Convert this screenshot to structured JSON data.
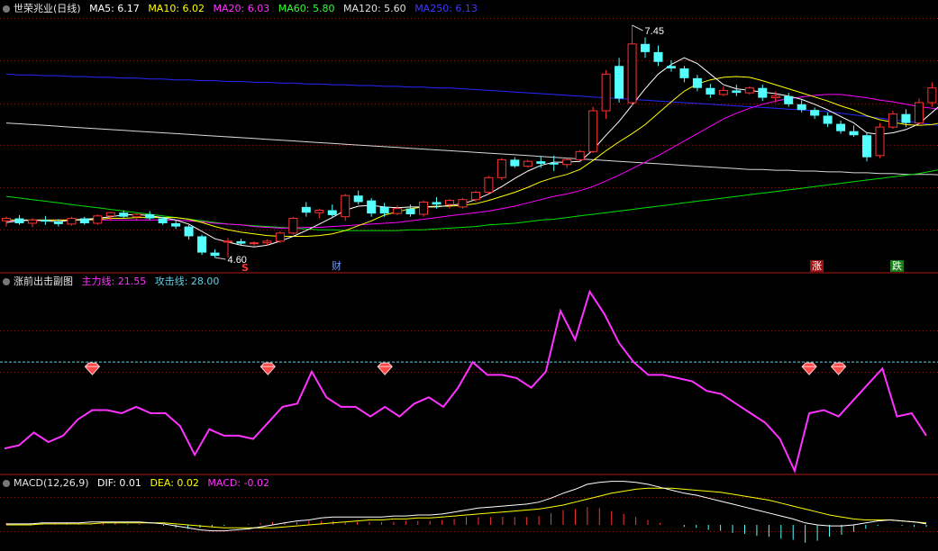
{
  "colors": {
    "bg": "#000000",
    "up": "#ff3232",
    "down": "#54ffff",
    "grid": "#8b1a1a",
    "ma5": "#ffffff",
    "ma10": "#ffff00",
    "ma20": "#ff00ff",
    "ma60": "#00e000",
    "ma120": "#d8d8d8",
    "ma250": "#2828ff",
    "main_line": "#ff33ff",
    "attack_line": "#5fd2e6",
    "dif": "#ffffff",
    "dea": "#ffff00",
    "macd_label": "#ff33ff"
  },
  "main_panel": {
    "stock_name": "世荣兆业",
    "period": "(日线)",
    "ma_labels": [
      {
        "label": "MA5: 6.17",
        "color": "#ffffff"
      },
      {
        "label": "MA10: 6.02",
        "color": "#ffff00"
      },
      {
        "label": "MA20: 6.03",
        "color": "#ff33ff"
      },
      {
        "label": "MA60: 5.80",
        "color": "#33ff33"
      },
      {
        "label": "MA120: 5.60",
        "color": "#e0e0e0"
      },
      {
        "label": "MA250: 6.13",
        "color": "#3b3bff"
      }
    ],
    "high_label": "7.45",
    "low_label": "4.60",
    "marker_s": "S",
    "marker_cai": "财",
    "marker_zhang": "涨",
    "marker_die": "跌"
  },
  "indicator_panel": {
    "name": "涨前出击副图",
    "main_label": "主力线: 21.55",
    "attack_label": "攻击线: 28.00"
  },
  "macd_panel": {
    "name": "MACD(12,26,9)",
    "dif_label": "DIF: 0.01",
    "dea_label": "DEA: 0.02",
    "macd_label": "MACD: -0.02"
  },
  "chart_data": {
    "type": "candlestick",
    "candles": [
      [
        5.05,
        5.1,
        4.98,
        5.08
      ],
      [
        5.08,
        5.12,
        5.0,
        5.02
      ],
      [
        5.02,
        5.08,
        4.97,
        5.06
      ],
      [
        5.06,
        5.11,
        5.0,
        5.04
      ],
      [
        5.04,
        5.07,
        4.98,
        5.01
      ],
      [
        5.01,
        5.1,
        4.99,
        5.08
      ],
      [
        5.08,
        5.1,
        5.0,
        5.02
      ],
      [
        5.02,
        5.13,
        5.0,
        5.11
      ],
      [
        5.11,
        5.16,
        5.05,
        5.15
      ],
      [
        5.15,
        5.18,
        5.08,
        5.1
      ],
      [
        5.1,
        5.14,
        5.05,
        5.13
      ],
      [
        5.13,
        5.17,
        5.06,
        5.08
      ],
      [
        5.08,
        5.1,
        5.0,
        5.02
      ],
      [
        5.02,
        5.06,
        4.95,
        4.98
      ],
      [
        4.98,
        5.0,
        4.82,
        4.86
      ],
      [
        4.86,
        4.88,
        4.63,
        4.66
      ],
      [
        4.66,
        4.7,
        4.6,
        4.62
      ],
      [
        4.79,
        4.84,
        4.6,
        4.8
      ],
      [
        4.8,
        4.83,
        4.75,
        4.77
      ],
      [
        4.77,
        4.8,
        4.74,
        4.78
      ],
      [
        4.78,
        4.82,
        4.75,
        4.8
      ],
      [
        4.8,
        4.92,
        4.78,
        4.9
      ],
      [
        4.9,
        5.1,
        4.88,
        5.08
      ],
      [
        5.22,
        5.28,
        5.1,
        5.15
      ],
      [
        5.15,
        5.2,
        5.08,
        5.18
      ],
      [
        5.18,
        5.25,
        5.1,
        5.12
      ],
      [
        5.1,
        5.38,
        5.05,
        5.36
      ],
      [
        5.36,
        5.42,
        5.25,
        5.28
      ],
      [
        5.3,
        5.33,
        5.1,
        5.14
      ],
      [
        5.22,
        5.27,
        5.1,
        5.14
      ],
      [
        5.14,
        5.24,
        5.12,
        5.2
      ],
      [
        5.2,
        5.25,
        5.1,
        5.13
      ],
      [
        5.13,
        5.3,
        5.1,
        5.28
      ],
      [
        5.28,
        5.34,
        5.2,
        5.25
      ],
      [
        5.25,
        5.32,
        5.2,
        5.3
      ],
      [
        5.22,
        5.33,
        5.2,
        5.31
      ],
      [
        5.31,
        5.42,
        5.28,
        5.4
      ],
      [
        5.4,
        5.6,
        5.38,
        5.58
      ],
      [
        5.58,
        5.82,
        5.55,
        5.8
      ],
      [
        5.8,
        5.83,
        5.7,
        5.72
      ],
      [
        5.72,
        5.8,
        5.7,
        5.78
      ],
      [
        5.78,
        5.84,
        5.7,
        5.75
      ],
      [
        5.76,
        5.85,
        5.66,
        5.74
      ],
      [
        5.74,
        5.82,
        5.7,
        5.8
      ],
      [
        5.8,
        5.92,
        5.78,
        5.9
      ],
      [
        5.9,
        6.45,
        5.88,
        6.4
      ],
      [
        6.4,
        6.9,
        6.3,
        6.85
      ],
      [
        6.95,
        7.05,
        6.5,
        6.55
      ],
      [
        6.5,
        7.45,
        6.45,
        7.22
      ],
      [
        7.22,
        7.3,
        7.05,
        7.12
      ],
      [
        7.12,
        7.2,
        6.95,
        7.0
      ],
      [
        6.95,
        7.02,
        6.88,
        6.92
      ],
      [
        6.92,
        6.95,
        6.75,
        6.8
      ],
      [
        6.8,
        6.84,
        6.64,
        6.68
      ],
      [
        6.68,
        6.73,
        6.56,
        6.6
      ],
      [
        6.6,
        6.7,
        6.58,
        6.65
      ],
      [
        6.65,
        6.72,
        6.58,
        6.62
      ],
      [
        6.62,
        6.7,
        6.6,
        6.68
      ],
      [
        6.68,
        6.72,
        6.52,
        6.56
      ],
      [
        6.56,
        6.64,
        6.5,
        6.58
      ],
      [
        6.58,
        6.62,
        6.45,
        6.48
      ],
      [
        6.48,
        6.53,
        6.38,
        6.41
      ],
      [
        6.41,
        6.44,
        6.3,
        6.34
      ],
      [
        6.34,
        6.38,
        6.2,
        6.24
      ],
      [
        6.24,
        6.28,
        6.12,
        6.15
      ],
      [
        6.15,
        6.22,
        6.08,
        6.1
      ],
      [
        6.1,
        6.13,
        5.78,
        5.83
      ],
      [
        5.85,
        6.25,
        5.82,
        6.2
      ],
      [
        6.2,
        6.4,
        6.18,
        6.36
      ],
      [
        6.36,
        6.42,
        6.2,
        6.25
      ],
      [
        6.25,
        6.55,
        6.22,
        6.5
      ],
      [
        6.5,
        6.75,
        6.45,
        6.68
      ],
      [
        6.68,
        6.95,
        6.6,
        6.9
      ],
      [
        6.9,
        7.12,
        6.55,
        6.62
      ],
      [
        6.62,
        6.75,
        6.18,
        6.35
      ],
      [
        6.35,
        6.4,
        6.14,
        6.18
      ],
      [
        6.32,
        6.36,
        6.22,
        6.25
      ]
    ],
    "ma5": [
      5.03,
      5.05,
      5.06,
      5.05,
      5.04,
      5.06,
      5.07,
      5.08,
      5.1,
      5.12,
      5.13,
      5.11,
      5.09,
      5.06,
      5.01,
      4.92,
      4.83,
      4.79,
      4.75,
      4.73,
      4.75,
      4.8,
      4.86,
      4.93,
      5.01,
      5.09,
      5.18,
      5.23,
      5.24,
      5.22,
      5.21,
      5.22,
      5.22,
      5.22,
      5.24,
      5.26,
      5.31,
      5.38,
      5.47,
      5.57,
      5.66,
      5.73,
      5.77,
      5.77,
      5.78,
      5.92,
      6.1,
      6.27,
      6.47,
      6.67,
      6.85,
      6.97,
      7.05,
      6.98,
      6.85,
      6.72,
      6.67,
      6.65,
      6.63,
      6.61,
      6.58,
      6.54,
      6.48,
      6.41,
      6.33,
      6.25,
      6.13,
      6.11,
      6.13,
      6.17,
      6.24,
      6.38,
      6.52,
      6.6,
      6.58,
      6.51,
      6.45
    ],
    "ma10": [
      5.06,
      5.06,
      5.06,
      5.06,
      5.06,
      5.06,
      5.06,
      5.07,
      5.08,
      5.08,
      5.09,
      5.09,
      5.09,
      5.09,
      5.07,
      5.03,
      4.98,
      4.94,
      4.91,
      4.89,
      4.87,
      4.86,
      4.86,
      4.86,
      4.87,
      4.89,
      4.93,
      4.99,
      5.05,
      5.12,
      5.16,
      5.2,
      5.22,
      5.23,
      5.23,
      5.24,
      5.26,
      5.3,
      5.35,
      5.4,
      5.46,
      5.53,
      5.58,
      5.62,
      5.68,
      5.79,
      5.91,
      6.02,
      6.12,
      6.23,
      6.37,
      6.51,
      6.64,
      6.73,
      6.78,
      6.81,
      6.82,
      6.81,
      6.77,
      6.72,
      6.67,
      6.62,
      6.57,
      6.52,
      6.46,
      6.41,
      6.34,
      6.29,
      6.26,
      6.23,
      6.22,
      6.23,
      6.26,
      6.31,
      6.35,
      6.38,
      6.44
    ],
    "ma20": [
      5.05,
      5.05,
      5.06,
      5.06,
      5.06,
      5.06,
      5.06,
      5.06,
      5.06,
      5.06,
      5.06,
      5.06,
      5.06,
      5.06,
      5.05,
      5.04,
      5.02,
      5.01,
      5.0,
      4.98,
      4.97,
      4.96,
      4.96,
      4.97,
      4.97,
      4.98,
      4.99,
      5.0,
      5.01,
      5.02,
      5.03,
      5.05,
      5.07,
      5.09,
      5.11,
      5.13,
      5.15,
      5.17,
      5.2,
      5.23,
      5.27,
      5.31,
      5.35,
      5.38,
      5.42,
      5.47,
      5.54,
      5.61,
      5.69,
      5.77,
      5.85,
      5.94,
      6.03,
      6.12,
      6.21,
      6.3,
      6.37,
      6.43,
      6.48,
      6.52,
      6.55,
      6.57,
      6.59,
      6.6,
      6.6,
      6.58,
      6.56,
      6.53,
      6.51,
      6.48,
      6.45,
      6.43,
      6.41,
      6.39,
      6.36,
      6.33,
      6.3
    ],
    "ma60": [
      5.35,
      5.33,
      5.31,
      5.29,
      5.27,
      5.25,
      5.23,
      5.21,
      5.19,
      5.17,
      5.15,
      5.13,
      5.11,
      5.09,
      5.07,
      5.05,
      5.03,
      5.01,
      5.0,
      4.99,
      4.98,
      4.97,
      4.96,
      4.95,
      4.94,
      4.94,
      4.93,
      4.93,
      4.93,
      4.93,
      4.93,
      4.94,
      4.94,
      4.95,
      4.96,
      4.97,
      4.98,
      5.0,
      5.01,
      5.02,
      5.04,
      5.06,
      5.07,
      5.09,
      5.11,
      5.13,
      5.15,
      5.17,
      5.19,
      5.21,
      5.23,
      5.25,
      5.27,
      5.29,
      5.31,
      5.33,
      5.35,
      5.37,
      5.39,
      5.41,
      5.43,
      5.45,
      5.47,
      5.49,
      5.51,
      5.53,
      5.55,
      5.57,
      5.59,
      5.61,
      5.63,
      5.66,
      5.69,
      5.72,
      5.75,
      5.78,
      5.8
    ],
    "ma120": [
      6.25,
      6.24,
      6.23,
      6.22,
      6.21,
      6.2,
      6.19,
      6.18,
      6.17,
      6.16,
      6.15,
      6.14,
      6.13,
      6.12,
      6.11,
      6.1,
      6.09,
      6.08,
      6.07,
      6.06,
      6.05,
      6.04,
      6.03,
      6.02,
      6.01,
      6.0,
      5.99,
      5.98,
      5.97,
      5.96,
      5.95,
      5.94,
      5.93,
      5.92,
      5.91,
      5.9,
      5.89,
      5.88,
      5.87,
      5.86,
      5.85,
      5.84,
      5.83,
      5.82,
      5.81,
      5.8,
      5.79,
      5.78,
      5.77,
      5.76,
      5.75,
      5.74,
      5.73,
      5.72,
      5.71,
      5.7,
      5.69,
      5.68,
      5.68,
      5.67,
      5.67,
      5.66,
      5.66,
      5.65,
      5.65,
      5.64,
      5.64,
      5.63,
      5.63,
      5.62,
      5.62,
      5.62,
      5.61,
      5.61,
      5.61,
      5.6,
      5.6
    ],
    "ma250": [
      6.85,
      6.84,
      6.84,
      6.83,
      6.83,
      6.82,
      6.82,
      6.81,
      6.81,
      6.8,
      6.8,
      6.79,
      6.79,
      6.78,
      6.78,
      6.77,
      6.77,
      6.76,
      6.76,
      6.75,
      6.75,
      6.74,
      6.74,
      6.73,
      6.73,
      6.72,
      6.72,
      6.71,
      6.71,
      6.7,
      6.7,
      6.69,
      6.69,
      6.68,
      6.68,
      6.67,
      6.66,
      6.65,
      6.64,
      6.63,
      6.62,
      6.61,
      6.6,
      6.59,
      6.58,
      6.57,
      6.56,
      6.55,
      6.54,
      6.53,
      6.52,
      6.51,
      6.5,
      6.49,
      6.48,
      6.47,
      6.46,
      6.45,
      6.44,
      6.43,
      6.42,
      6.41,
      6.4,
      6.39,
      6.37,
      6.35,
      6.33,
      6.31,
      6.29,
      6.27,
      6.25,
      6.23,
      6.21,
      6.19,
      6.17,
      6.15,
      6.13
    ],
    "main_line": [
      1,
      2,
      6,
      3,
      5,
      10,
      13,
      13,
      12,
      14,
      12,
      12,
      8,
      -1,
      7,
      5,
      5,
      4,
      9,
      14,
      15,
      25,
      17,
      14,
      14,
      11,
      14,
      11,
      15,
      17,
      14,
      20,
      28,
      24,
      24,
      23,
      20,
      25,
      44,
      35,
      50,
      43,
      34,
      28,
      24,
      24,
      23,
      22,
      19,
      18,
      15,
      12,
      9,
      4,
      -6,
      12,
      13,
      11,
      16,
      21,
      26,
      11,
      12,
      5
    ],
    "attack_line": 28.0,
    "signals": [
      6,
      18,
      26,
      55,
      57
    ],
    "macd_hist": [
      0.02,
      0.01,
      0.02,
      0.01,
      0.01,
      0.02,
      0.01,
      0.01,
      0.02,
      0.02,
      0.01,
      0.01,
      0.0,
      -0.01,
      -0.03,
      -0.04,
      -0.03,
      -0.02,
      -0.01,
      0.0,
      0.01,
      0.02,
      0.03,
      0.03,
      0.03,
      0.04,
      0.04,
      0.04,
      0.03,
      0.03,
      0.03,
      0.03,
      0.03,
      0.04,
      0.04,
      0.04,
      0.05,
      0.06,
      0.08,
      0.08,
      0.08,
      0.08,
      0.08,
      0.08,
      0.09,
      0.12,
      0.15,
      0.16,
      0.18,
      0.17,
      0.14,
      0.11,
      0.08,
      0.05,
      0.02,
      0.0,
      -0.02,
      -0.03,
      -0.05,
      -0.06,
      -0.08,
      -0.09,
      -0.11,
      -0.12,
      -0.14,
      -0.15,
      -0.18,
      -0.16,
      -0.12,
      -0.1,
      -0.07,
      -0.04,
      -0.01,
      0.0,
      -0.01,
      -0.02,
      -0.02
    ],
    "dif": [
      0.01,
      0.01,
      0.01,
      0.02,
      0.02,
      0.02,
      0.02,
      0.03,
      0.03,
      0.03,
      0.03,
      0.03,
      0.02,
      0.01,
      -0.01,
      -0.03,
      -0.05,
      -0.06,
      -0.06,
      -0.05,
      -0.04,
      -0.02,
      0.0,
      0.02,
      0.04,
      0.05,
      0.07,
      0.08,
      0.08,
      0.08,
      0.08,
      0.08,
      0.09,
      0.09,
      0.1,
      0.1,
      0.11,
      0.13,
      0.15,
      0.17,
      0.18,
      0.19,
      0.2,
      0.21,
      0.23,
      0.27,
      0.32,
      0.36,
      0.41,
      0.43,
      0.44,
      0.44,
      0.43,
      0.41,
      0.38,
      0.35,
      0.32,
      0.3,
      0.27,
      0.24,
      0.21,
      0.18,
      0.15,
      0.12,
      0.09,
      0.06,
      0.02,
      0.0,
      -0.01,
      -0.01,
      0.0,
      0.02,
      0.04,
      0.05,
      0.04,
      0.03,
      0.01
    ],
    "dea": [
      0.0,
      0.0,
      0.0,
      0.01,
      0.01,
      0.01,
      0.01,
      0.01,
      0.02,
      0.02,
      0.02,
      0.02,
      0.02,
      0.02,
      0.01,
      0.0,
      -0.01,
      -0.02,
      -0.03,
      -0.03,
      -0.03,
      -0.03,
      -0.03,
      -0.02,
      -0.01,
      0.0,
      0.01,
      0.02,
      0.03,
      0.04,
      0.05,
      0.05,
      0.06,
      0.06,
      0.07,
      0.07,
      0.08,
      0.09,
      0.1,
      0.11,
      0.12,
      0.13,
      0.14,
      0.15,
      0.16,
      0.18,
      0.2,
      0.23,
      0.26,
      0.29,
      0.32,
      0.34,
      0.36,
      0.37,
      0.37,
      0.37,
      0.36,
      0.35,
      0.34,
      0.33,
      0.31,
      0.29,
      0.27,
      0.25,
      0.22,
      0.19,
      0.16,
      0.13,
      0.1,
      0.08,
      0.06,
      0.05,
      0.05,
      0.05,
      0.04,
      0.03,
      0.02
    ]
  }
}
